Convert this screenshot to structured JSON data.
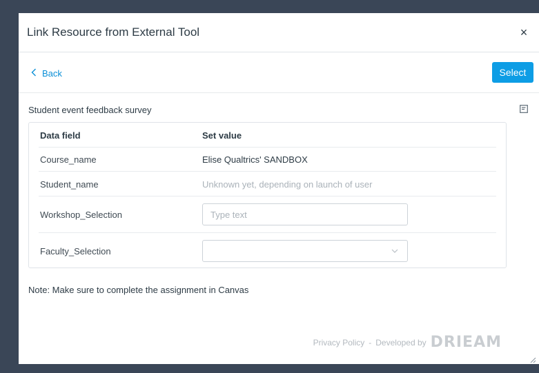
{
  "modal": {
    "title": "Link Resource from External Tool",
    "close_label": "×"
  },
  "toolbar": {
    "back_label": "Back",
    "select_label": "Select"
  },
  "survey": {
    "title": "Student event feedback survey"
  },
  "table": {
    "headers": {
      "field": "Data field",
      "value": "Set value"
    },
    "rows": [
      {
        "field": "Course_name",
        "value": "Elise Qualtrics' SANDBOX"
      },
      {
        "field": "Student_name",
        "value": "Unknown yet, depending on launch of user"
      },
      {
        "field": "Workshop_Selection",
        "placeholder": "Type text",
        "input_value": ""
      },
      {
        "field": "Faculty_Selection",
        "selected_value": ""
      }
    ]
  },
  "note": "Note: Make sure to complete the assignment in Canvas",
  "footer": {
    "privacy_label": "Privacy Policy",
    "separator": " - ",
    "developed_by": "Developed by",
    "brand": "DRIEAM"
  },
  "colors": {
    "accent": "#0d9de5",
    "link": "#0a8fd7",
    "backdrop": "#3a4657"
  },
  "icons": {
    "close": "close-icon",
    "back": "chevron-left-icon",
    "collapse": "collapse-panel-icon",
    "dropdown": "chevron-down-icon",
    "resize": "resize-handle-icon"
  }
}
